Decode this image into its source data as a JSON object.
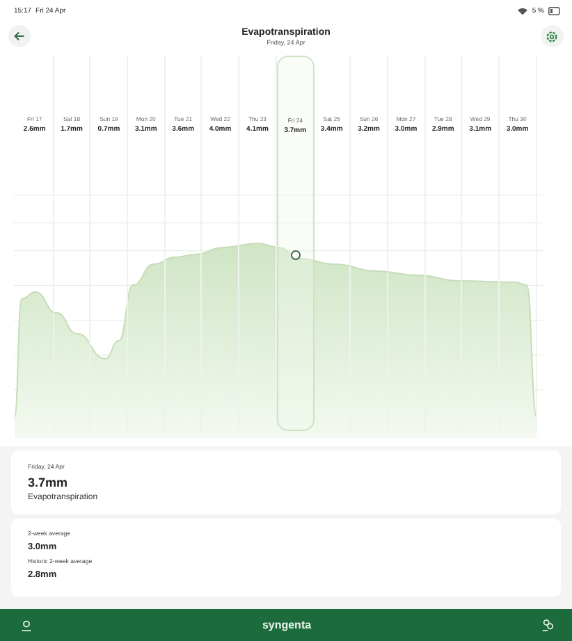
{
  "status_bar": {
    "time": "15:17",
    "date": "Fri 24 Apr",
    "battery": "5 %"
  },
  "header": {
    "title": "Evapotranspiration",
    "subtitle": "Friday, 24 Apr"
  },
  "days": [
    {
      "label": "Fri 17",
      "value": "2.6mm",
      "selected": false
    },
    {
      "label": "Sat 18",
      "value": "1.7mm",
      "selected": false
    },
    {
      "label": "Sun 19",
      "value": "0.7mm",
      "selected": false
    },
    {
      "label": "Mon 20",
      "value": "3.1mm",
      "selected": false
    },
    {
      "label": "Tue 21",
      "value": "3.6mm",
      "selected": false
    },
    {
      "label": "Wed 22",
      "value": "4.0mm",
      "selected": false
    },
    {
      "label": "Thu 23",
      "value": "4.1mm",
      "selected": false
    },
    {
      "label": "Fri 24",
      "value": "3.7mm",
      "selected": true
    },
    {
      "label": "Sat 25",
      "value": "3.4mm",
      "selected": false
    },
    {
      "label": "Sun 26",
      "value": "3.2mm",
      "selected": false
    },
    {
      "label": "Mon 27",
      "value": "3.0mm",
      "selected": false
    },
    {
      "label": "Tue 28",
      "value": "2.9mm",
      "selected": false
    },
    {
      "label": "Wed 29",
      "value": "3.1mm",
      "selected": false
    },
    {
      "label": "Thu 30",
      "value": "3.0mm",
      "selected": false
    }
  ],
  "detail_card": {
    "date": "Friday, 24 Apr",
    "value": "3.7mm",
    "label": "Evapotranspiration"
  },
  "averages_card": [
    {
      "label": "2-week average",
      "value": "3.0mm"
    },
    {
      "label": "Historic 2-week average",
      "value": "2.8mm"
    }
  ],
  "footer": {
    "brand": "syngenta"
  }
}
